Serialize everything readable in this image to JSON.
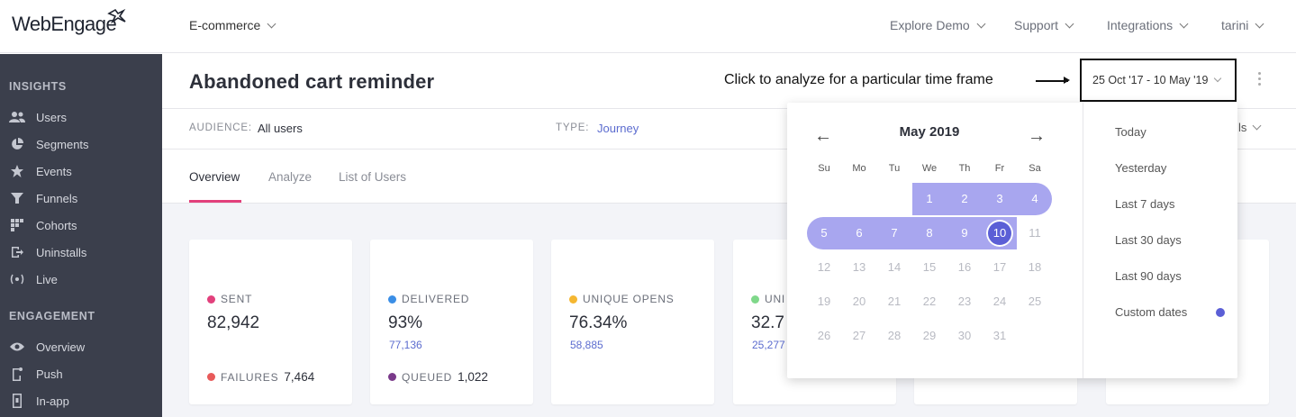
{
  "topbar": {
    "logo": "WebEngage",
    "project": "E-commerce",
    "nav": [
      "Explore Demo",
      "Support",
      "Integrations",
      "tarini"
    ]
  },
  "sidebar": {
    "section1": "INSIGHTS",
    "insights": [
      {
        "label": "Users",
        "icon": "users-icon"
      },
      {
        "label": "Segments",
        "icon": "pie-icon"
      },
      {
        "label": "Events",
        "icon": "star-icon"
      },
      {
        "label": "Funnels",
        "icon": "funnel-icon"
      },
      {
        "label": "Cohorts",
        "icon": "grid-icon"
      },
      {
        "label": "Uninstalls",
        "icon": "exit-icon"
      },
      {
        "label": "Live",
        "icon": "broadcast-icon"
      }
    ],
    "section2": "ENGAGEMENT",
    "engagement": [
      {
        "label": "Overview",
        "icon": "eye-icon"
      },
      {
        "label": "Push",
        "icon": "phone-icon"
      },
      {
        "label": "In-app",
        "icon": "device-icon"
      }
    ]
  },
  "header": {
    "title": "Abandoned cart reminder",
    "hint": "Click to analyze for a particular time frame",
    "date_range": "25 Oct '17 - 10 May '19"
  },
  "meta": {
    "audience_label": "AUDIENCE:",
    "audience_value": "All users",
    "type_label": "TYPE:",
    "type_value": "Journey",
    "details_partial": "ls"
  },
  "tabs": [
    "Overview",
    "Analyze",
    "List of Users"
  ],
  "cards": [
    {
      "label": "SENT",
      "color": "#e2407c",
      "value": "82,942",
      "sub": "",
      "foot_label": "FAILURES",
      "foot_color": "#e85a5a",
      "foot_value": "7,464"
    },
    {
      "label": "DELIVERED",
      "color": "#3a8ee6",
      "value": "93%",
      "sub": "77,136",
      "foot_label": "QUEUED",
      "foot_color": "#7a3a8a",
      "foot_value": "1,022"
    },
    {
      "label": "UNIQUE OPENS",
      "color": "#f5b731",
      "value": "76.34%",
      "sub": "58,885",
      "foot_label": "",
      "foot_color": "",
      "foot_value": ""
    },
    {
      "label": "UNI",
      "color": "#7fd88a",
      "value": "32.7",
      "sub": "25,277",
      "foot_label": "",
      "foot_color": "",
      "foot_value": ""
    }
  ],
  "calendar": {
    "month": "May 2019",
    "prev": "←",
    "next": "→",
    "weekdays": [
      "Su",
      "Mo",
      "Tu",
      "We",
      "Th",
      "Fr",
      "Sa"
    ],
    "first_weekday": 3,
    "days_in_month": 31,
    "range_end": 10,
    "selected": 10,
    "accent": "#5b5fd6",
    "range_color": "#a8a6ef"
  },
  "presets": [
    "Today",
    "Yesterday",
    "Last 7 days",
    "Last 30 days",
    "Last 90 days",
    "Custom dates"
  ],
  "active_preset": "Custom dates"
}
